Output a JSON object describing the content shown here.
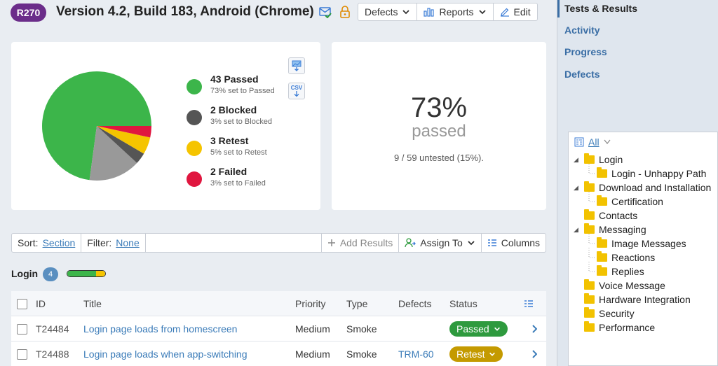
{
  "header": {
    "run_id": "R270",
    "title": "Version 4.2, Build 183, Android (Chrome)",
    "buttons": {
      "defects": "Defects",
      "reports": "Reports",
      "edit": "Edit"
    }
  },
  "summary": {
    "legend": [
      {
        "label": "43 Passed",
        "sub": "73% set to Passed",
        "color": "#3cb54a"
      },
      {
        "label": "2 Blocked",
        "sub": "3% set to Blocked",
        "color": "#555555"
      },
      {
        "label": "3 Retest",
        "sub": "5% set to Retest",
        "color": "#f5c400"
      },
      {
        "label": "2 Failed",
        "sub": "3% set to Failed",
        "color": "#e0163f"
      }
    ],
    "export_csv": "CSV",
    "percent": "73%",
    "percent_label": "passed",
    "untested": "9 / 59 untested (15%)."
  },
  "chart_data": {
    "type": "pie",
    "slices": [
      {
        "name": "Passed",
        "value": 43,
        "color": "#3cb54a"
      },
      {
        "name": "Untested",
        "value": 9,
        "color": "#999999"
      },
      {
        "name": "Blocked",
        "value": 2,
        "color": "#555555"
      },
      {
        "name": "Retest",
        "value": 3,
        "color": "#f5c400"
      },
      {
        "name": "Failed",
        "value": 2,
        "color": "#e0163f"
      }
    ]
  },
  "toolbar": {
    "sort_label": "Sort:",
    "sort_value": "Section",
    "filter_label": "Filter:",
    "filter_value": "None",
    "add_results": "Add Results",
    "assign_to": "Assign To",
    "columns": "Columns"
  },
  "section": {
    "title": "Login",
    "count": "4",
    "progress": [
      {
        "fraction": 0.75,
        "color": "#3cb54a"
      },
      {
        "fraction": 0.25,
        "color": "#f5c400"
      }
    ]
  },
  "table": {
    "headers": {
      "id": "ID",
      "title": "Title",
      "priority": "Priority",
      "type": "Type",
      "defects": "Defects",
      "status": "Status"
    },
    "rows": [
      {
        "id": "T24484",
        "title": "Login page loads from homescreen",
        "priority": "Medium",
        "type": "Smoke",
        "defects": "",
        "status": "Passed",
        "status_color": "#2e9a3e"
      },
      {
        "id": "T24488",
        "title": "Login page loads when app-switching",
        "priority": "Medium",
        "type": "Smoke",
        "defects": "TRM-60",
        "status": "Retest",
        "status_color": "#c49a00"
      }
    ]
  },
  "nav": {
    "items": [
      "Tests & Results",
      "Activity",
      "Progress",
      "Defects"
    ]
  },
  "tree": {
    "filter_label": "All",
    "nodes": [
      {
        "label": "Login",
        "level": 0,
        "expanded": true
      },
      {
        "label": "Login - Unhappy Path",
        "level": 1
      },
      {
        "label": "Download and Installation",
        "level": 0,
        "expanded": true
      },
      {
        "label": "Certification",
        "level": 1
      },
      {
        "label": "Contacts",
        "level": 0
      },
      {
        "label": "Messaging",
        "level": 0,
        "expanded": true
      },
      {
        "label": "Image Messages",
        "level": 1
      },
      {
        "label": "Reactions",
        "level": 1
      },
      {
        "label": "Replies",
        "level": 1
      },
      {
        "label": "Voice Message",
        "level": 0
      },
      {
        "label": "Hardware Integration",
        "level": 0
      },
      {
        "label": "Security",
        "level": 0
      },
      {
        "label": "Performance",
        "level": 0
      }
    ]
  }
}
